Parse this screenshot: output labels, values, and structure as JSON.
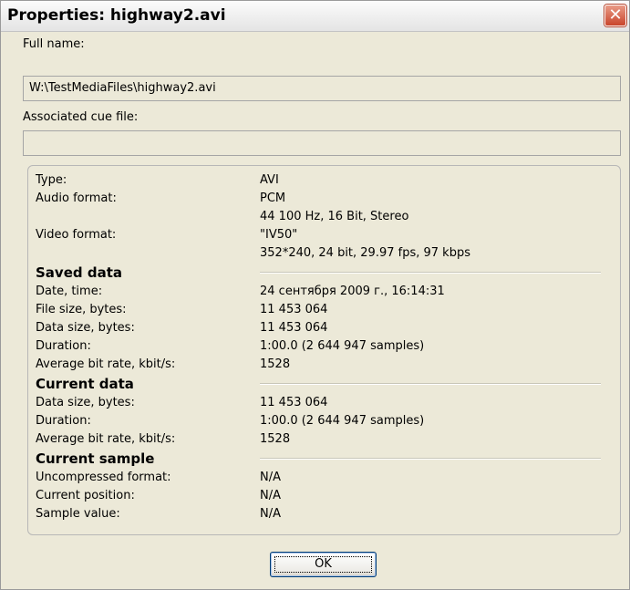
{
  "window": {
    "title": "Properties: highway2.avi",
    "close_glyph": "✕"
  },
  "full_name": {
    "label": "Full name:",
    "value": "W:\\TestMediaFiles\\highway2.avi"
  },
  "cue_file": {
    "label": "Associated cue file:",
    "value": ""
  },
  "info": {
    "type": {
      "key": "Type:",
      "value": "AVI"
    },
    "audio_format": {
      "key": "Audio format:",
      "value": "PCM",
      "detail": "44 100 Hz, 16 Bit, Stereo"
    },
    "video_format": {
      "key": "Video format:",
      "value": "\"IV50\"",
      "detail": "352*240, 24 bit, 29.97 fps, 97 kbps"
    }
  },
  "saved_data": {
    "heading": "Saved data",
    "rows": [
      {
        "key": "Date, time:",
        "value": "24 сентября 2009 г., 16:14:31"
      },
      {
        "key": "File size, bytes:",
        "value": "11 453 064"
      },
      {
        "key": "Data size, bytes:",
        "value": "11 453 064"
      },
      {
        "key": "Duration:",
        "value": "1:00.0 (2 644 947 samples)"
      },
      {
        "key": "Average bit rate, kbit/s:",
        "value": "1528"
      }
    ]
  },
  "current_data": {
    "heading": "Current data",
    "rows": [
      {
        "key": "Data size, bytes:",
        "value": "11 453 064"
      },
      {
        "key": "Duration:",
        "value": "1:00.0 (2 644 947 samples)"
      },
      {
        "key": "Average bit rate, kbit/s:",
        "value": "1528"
      }
    ]
  },
  "current_sample": {
    "heading": "Current sample",
    "rows": [
      {
        "key": "Uncompressed format:",
        "value": "N/A"
      },
      {
        "key": "Current position:",
        "value": "N/A"
      },
      {
        "key": "Sample value:",
        "value": "N/A"
      }
    ]
  },
  "buttons": {
    "ok_label": "OK"
  },
  "colors": {
    "dialog_bg": "#ece9d8",
    "close_button": "#c9452c",
    "button_border": "#003c74"
  }
}
